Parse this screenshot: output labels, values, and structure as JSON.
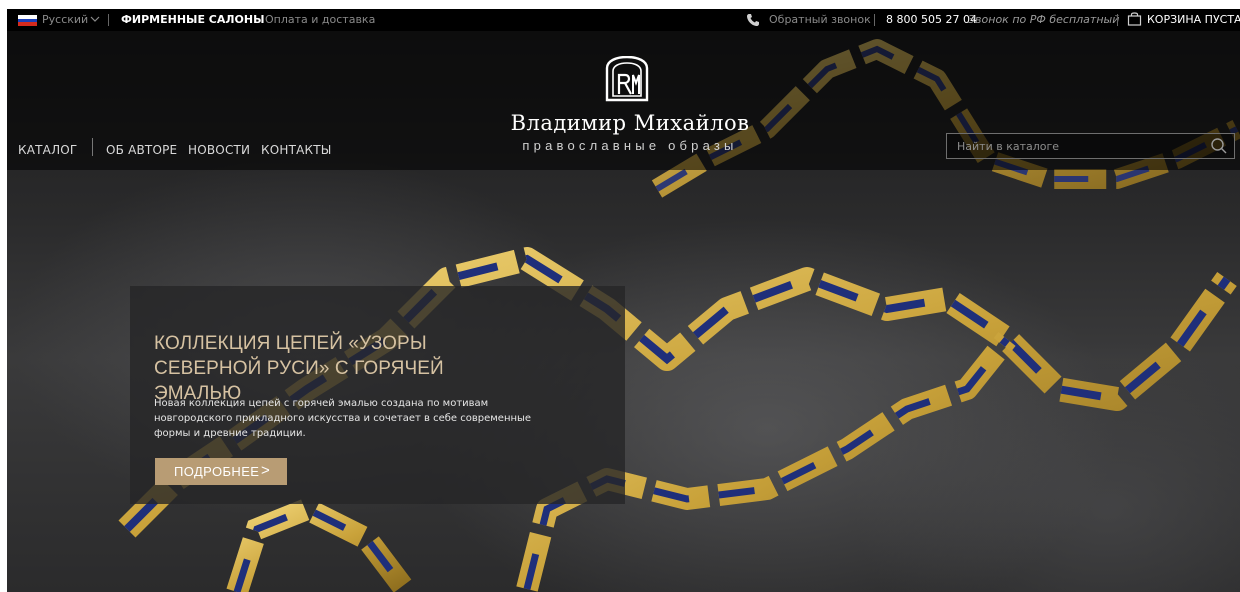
{
  "topbar": {
    "language": "Русский",
    "brand_salons": "ФИРМЕННЫЕ САЛОНЫ",
    "payment_delivery": "Оплата и доставка",
    "callback": "Обратный звонок",
    "phone": "8 800 505 27 04",
    "phone_note": "Звонок по РФ бесплатный",
    "cart": "КОРЗИНА ПУСТА"
  },
  "nav": {
    "items": [
      "КАТАЛОГ",
      "ОБ АВТОРЕ",
      "НОВОСТИ",
      "КОНТАКТЫ"
    ]
  },
  "logo": {
    "name": "Владимир Михайлов",
    "tagline": "православные образы"
  },
  "search": {
    "placeholder": "Найти в каталоге"
  },
  "promo": {
    "title": "КОЛЛЕКЦИЯ ЦЕПЕЙ «УЗОРЫ СЕВЕРНОЙ РУСИ» С ГОРЯЧЕЙ ЭМАЛЬЮ",
    "text": "Новая коллекция цепей с горячей эмалью создана по мотивам новгородского прикладного искусства и сочетает в себе современные формы и древние традиции.",
    "button": "ПОДРОБНЕЕ"
  },
  "colors": {
    "accent_gold": "#b89c74",
    "title_gold": "#d6c2a2",
    "flag": [
      "#ffffff",
      "#1c3fb8",
      "#d52b1e"
    ]
  },
  "icons": {
    "language": "russia-flag-icon",
    "language_dropdown": "chevron-down-icon",
    "callback": "phone-icon",
    "cart": "shopping-bag-icon",
    "search": "search-icon",
    "promo_button": "chevron-right-icon"
  }
}
